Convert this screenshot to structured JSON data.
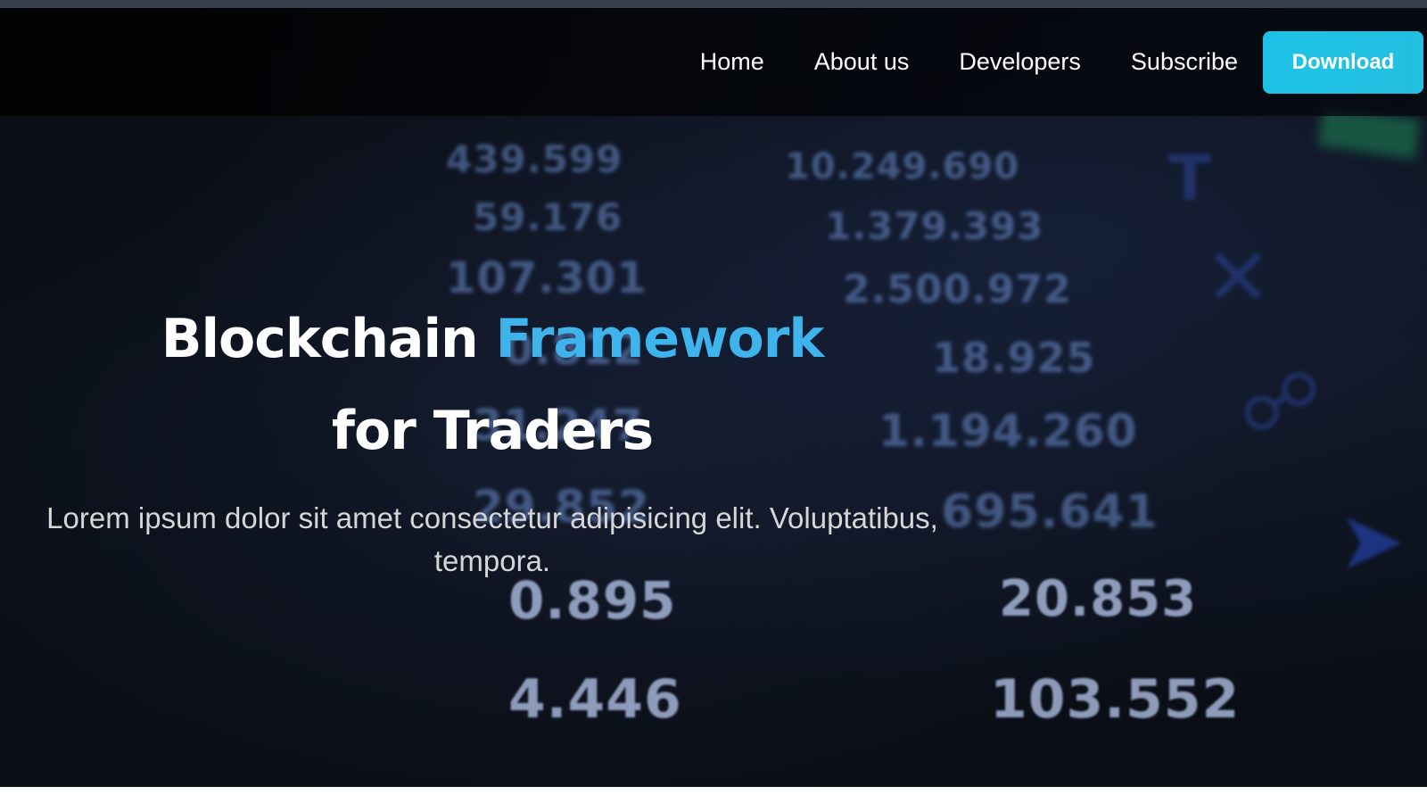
{
  "nav": {
    "items": [
      {
        "label": "Home"
      },
      {
        "label": "About us"
      },
      {
        "label": "Developers"
      },
      {
        "label": "Subscribe"
      }
    ],
    "download_label": "Download"
  },
  "hero": {
    "title_part1": "Blockchain",
    "title_accent": "Framework",
    "title_line2": "for Traders",
    "subtitle": "Lorem ipsum dolor sit amet consectetur adipisicing elit. Voluptatibus, tempora."
  },
  "background_numbers": [
    "439.599",
    "59.176",
    "107.301",
    "0.812",
    "31.247",
    "29.852",
    "0.895",
    "4.446",
    "10.249.690",
    "1.379.393",
    "2.500.972",
    "18.925",
    "1.194.260",
    "695.641",
    "20.853",
    "103.552"
  ],
  "colors": {
    "accent": "#3fb4ec",
    "button": "#1cc3e6",
    "background": "#0b1019",
    "text": "#ffffff"
  }
}
